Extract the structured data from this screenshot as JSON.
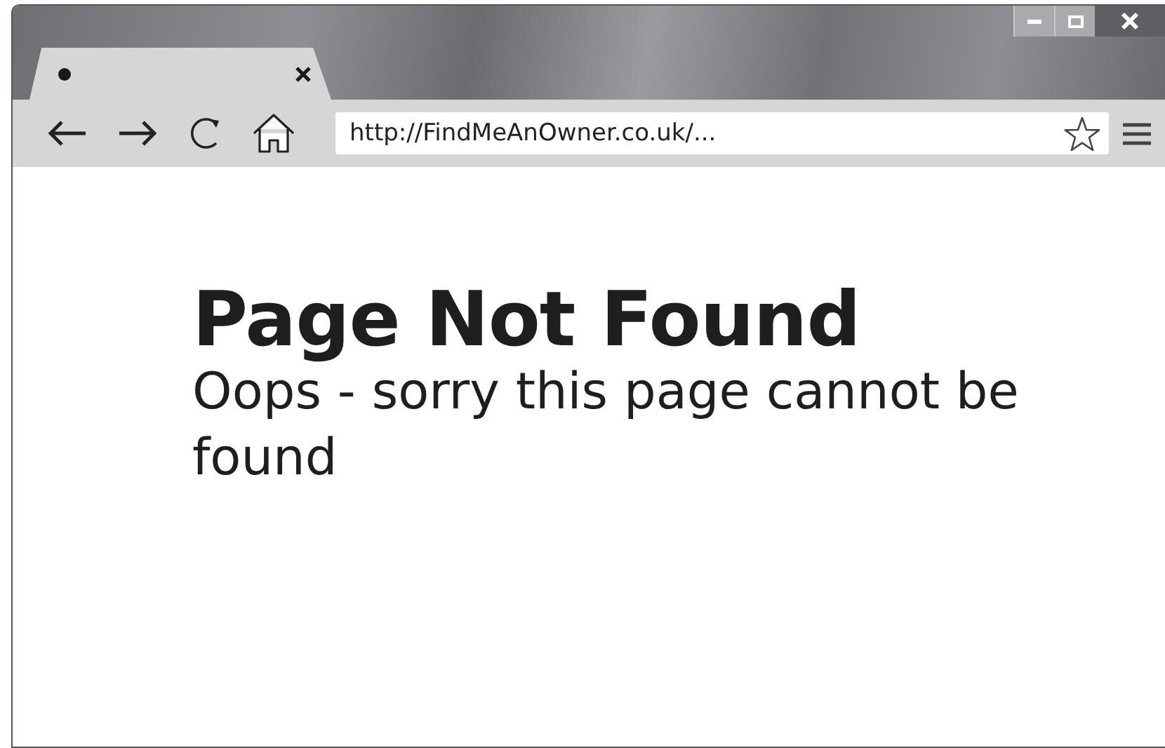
{
  "tabs": [
    {
      "selected": true
    }
  ],
  "address_bar": {
    "value": "http://FindMeAnOwner.co.uk/..."
  },
  "page": {
    "heading": "Page Not Found",
    "message": "Oops - sorry this page cannot be found"
  }
}
